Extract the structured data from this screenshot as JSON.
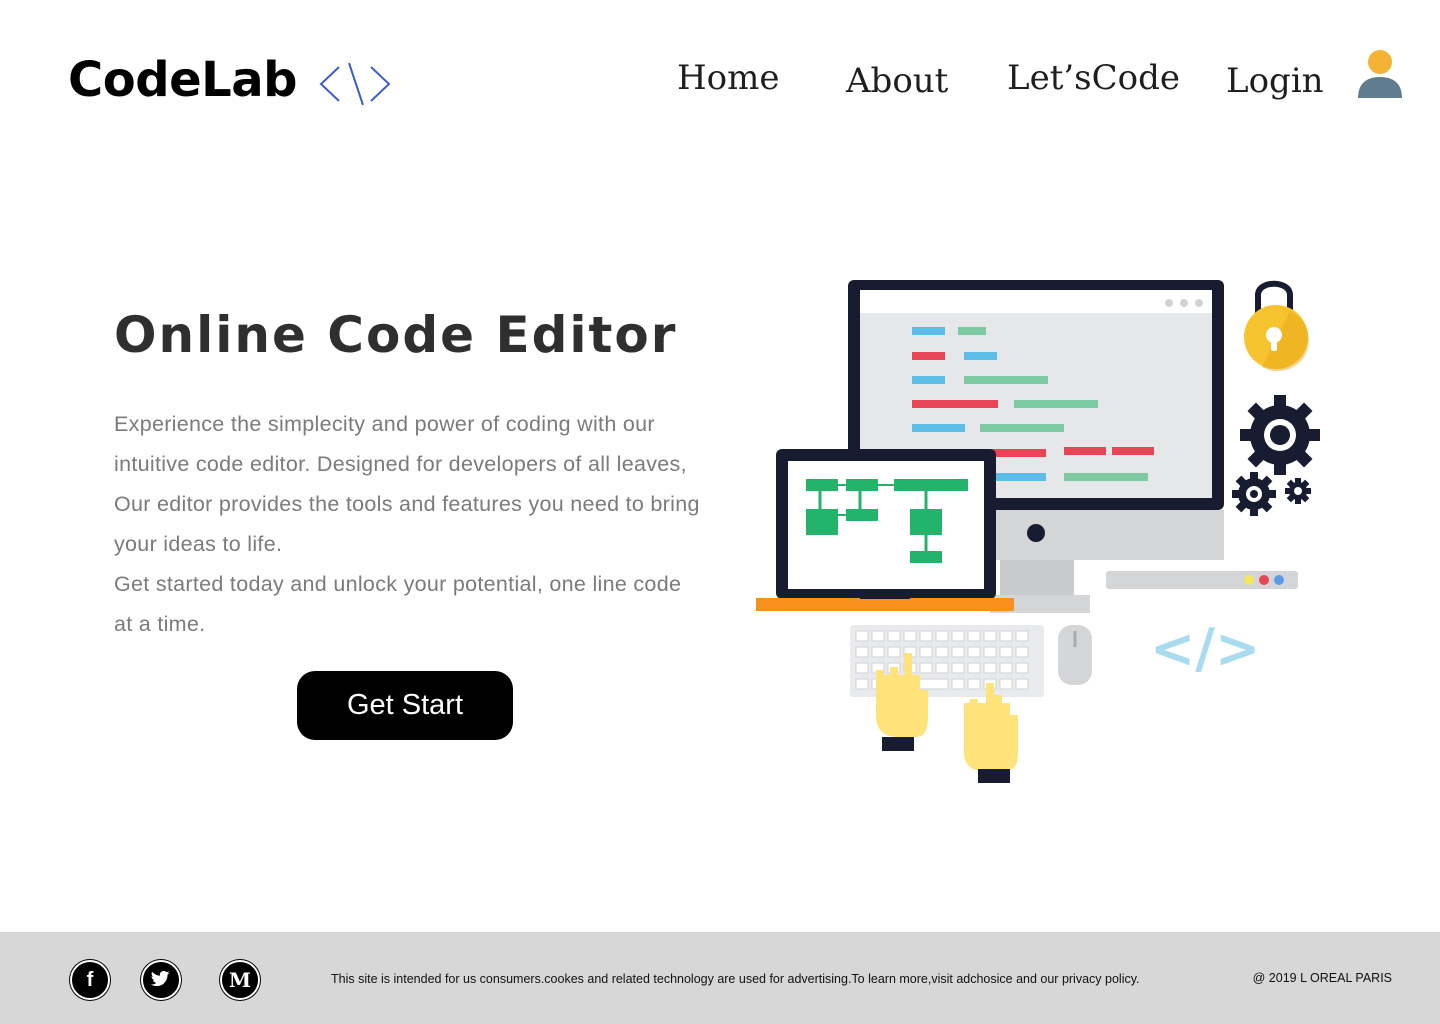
{
  "header": {
    "logo_text": "CodeLab",
    "logo_icon": "code-brackets-icon",
    "nav": [
      {
        "label": "Home"
      },
      {
        "label": "About"
      },
      {
        "label": "Let’sCode"
      },
      {
        "label": "Login"
      }
    ],
    "avatar_icon": "user-avatar-icon"
  },
  "hero": {
    "title": "Online Code Editor",
    "description": "Experience the simplecity and power of coding with our intuitive code editor. Designed for developers of all leaves, Our editor provides the tools and features you need to bring your ideas to life.",
    "description_2": "Get started today and unlock your potential, one line code at a time.",
    "cta_label": "Get Start"
  },
  "illustration": {
    "name": "coding-workstation-illustration",
    "code_tag": "</>"
  },
  "footer": {
    "social": [
      {
        "icon": "facebook-icon",
        "glyph": "f"
      },
      {
        "icon": "twitter-icon",
        "glyph": "🐦"
      },
      {
        "icon": "medium-icon",
        "glyph": "M"
      }
    ],
    "note": "This site is intended for us consumers.cookes and related technology are used for advertising.To learn more,visit adchosice and our privacy  policy.",
    "copyright": "@ 2019 L OREAL PARIS"
  },
  "colors": {
    "accent_blue": "#3a5fcd",
    "cta_bg": "#000000",
    "footer_bg": "#d7d7d7",
    "title_text": "#2f2f2f",
    "body_text": "#7b7b7b"
  }
}
